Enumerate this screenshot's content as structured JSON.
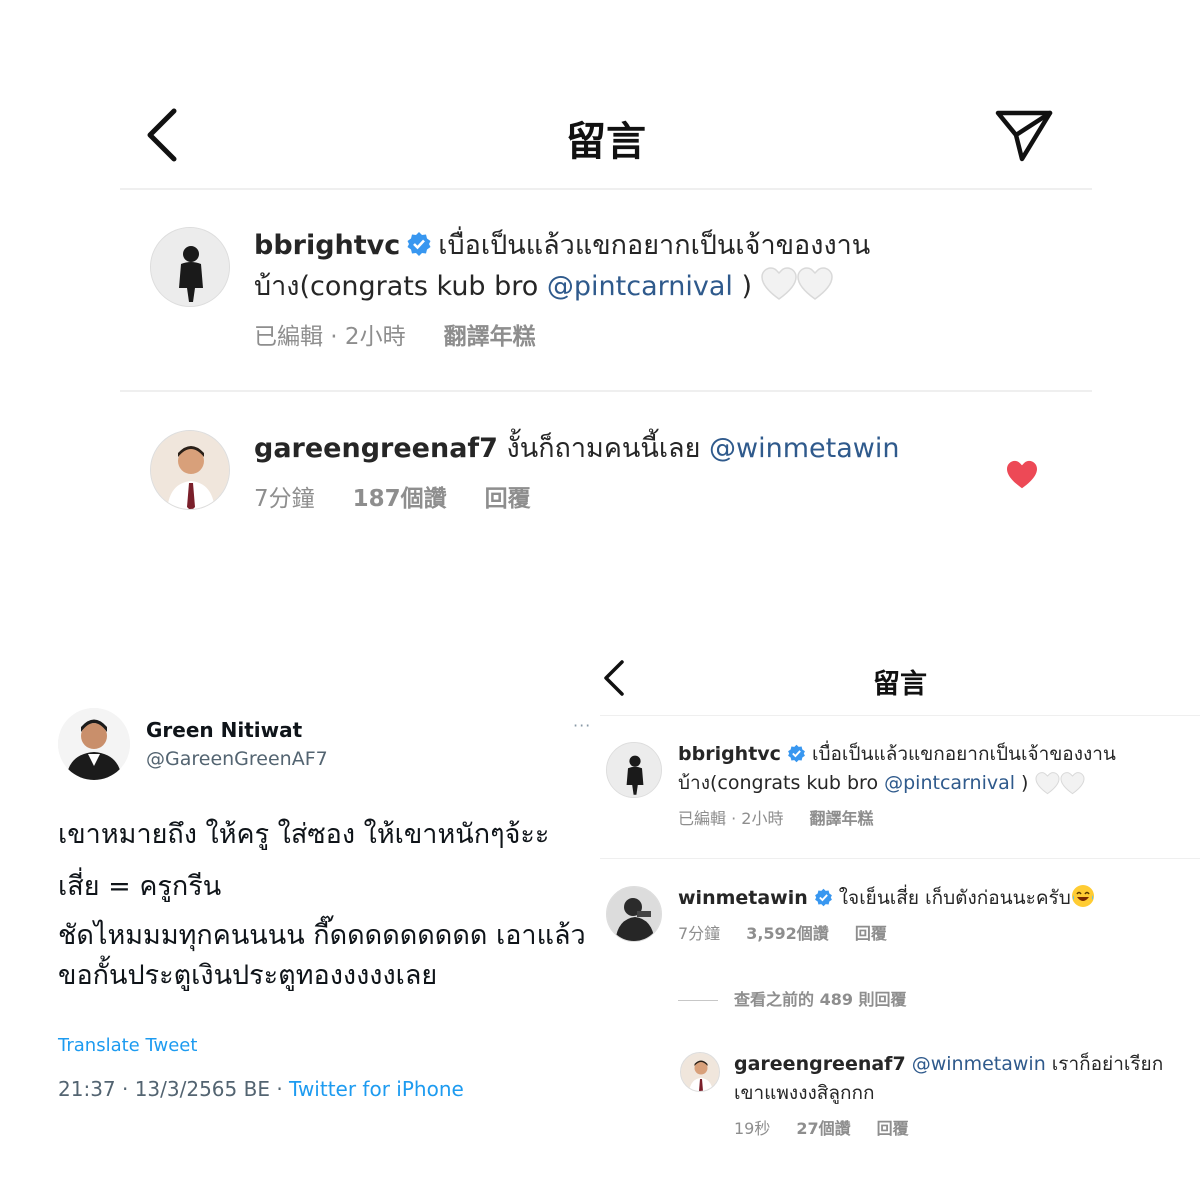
{
  "top_panel": {
    "title": "留言",
    "icons": {
      "back": "back-chevron-icon",
      "share": "send-icon"
    },
    "comments": [
      {
        "user": "bbrightvc",
        "verified": true,
        "text_before": "เบื่อเป็นแล้วแขกอยากเป็นเจ้าของงานบ้าง(congrats kub bro ",
        "mention": "@pintcarnival",
        "text_after": " )",
        "edited": "已編輯 · 2小時",
        "translate": "翻譯年糕"
      },
      {
        "user": "gareengreenaf7",
        "text": "งั้นก็ถามคนนี้เลย ",
        "mention": "@winmetawin",
        "time": "7分鐘",
        "likes": "187個讚",
        "reply": "回覆",
        "liked_color": "#ed4956"
      }
    ]
  },
  "tweet": {
    "name": "Green Nitiwat",
    "handle": "@GareenGreenAF7",
    "more": "···",
    "lines": [
      "เขาหมายถึง ให้ครู  ใส่ซอง ให้เขาหนักๆจ้ะะ",
      "เสี่ย = ครูกรีน",
      "ชัดไหมมมทุกคนนนน กี๊ดดดดดดดดด เอาแล้ว ขอกั้นประตูเงินประตูทองงงงงเลย"
    ],
    "translate": "Translate Tweet",
    "timestamp": "21:37 · 13/3/2565 BE · ",
    "source": "Twitter for iPhone",
    "link_color": "#1d9bf0"
  },
  "small_panel": {
    "title": "留言",
    "comments": [
      {
        "user": "bbrightvc",
        "text_before": "เบื่อเป็นแล้วแขกอยากเป็นเจ้าของงานบ้าง(congrats kub bro ",
        "mention": "@pintcarnival",
        "text_after": " )",
        "edited": "已編輯 · 2小時",
        "translate": "翻譯年糕"
      },
      {
        "user": "winmetawin",
        "text": "ใจเย็นเสี่ย เก็บตังก่อนนะครับ",
        "time": "7分鐘",
        "likes": "3,592個讚",
        "reply": "回覆"
      }
    ],
    "view_previous": "查看之前的 489 則回覆",
    "reply": {
      "user": "gareengreenaf7",
      "mention": "@winmetawin",
      "text": " เราก็อย่าเรียกเขาแพงงงสิลูกกก",
      "time": "19秒",
      "likes": "27個讚",
      "reply": "回覆"
    }
  }
}
